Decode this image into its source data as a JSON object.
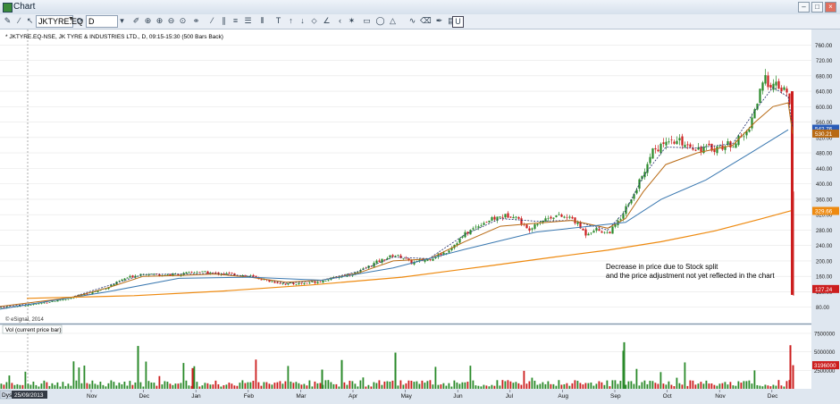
{
  "window": {
    "title": "Chart"
  },
  "toolbar": {
    "symbol": "JKTYRE.EQ",
    "interval": "D"
  },
  "chart_header": "* JKTYRE.EQ-NSE, JK TYRE & INDUSTRIES LTD., D, 09:15-15:30 (500 Bars Back)",
  "copyright": "© eSignal, 2014",
  "volume_pane_label": "Vol (current price bar)",
  "annotation": {
    "line1": "Decrease in price due to Stock split",
    "line2": "and the price adjustment not yet reflected in the chart"
  },
  "date_box": {
    "prefix": "Dys",
    "date": "25/09/2013"
  },
  "colors": {
    "up": "#2a8a2a",
    "down": "#cc1e1e",
    "ma_fast": "#1e2a6a",
    "ma_mid": "#b86a14",
    "ma_slow": "#3a78b0",
    "ma_long": "#ee8a10"
  },
  "chart_data": {
    "type": "line",
    "price_axis": {
      "ylim": [
        40,
        800
      ],
      "ticks": [
        80,
        120,
        160,
        200,
        240,
        280,
        320,
        360,
        400,
        440,
        480,
        520,
        560,
        600,
        640,
        680,
        720,
        760
      ]
    },
    "volume_axis": {
      "ylim": [
        0,
        7500000
      ],
      "ticks": [
        2500000,
        5000000,
        7500000
      ],
      "tick_labels": [
        "2500000",
        "5000000",
        "7500000"
      ]
    },
    "months": [
      "Nov",
      "Dec",
      "Jan",
      "Feb",
      "Mar",
      "Apr",
      "May",
      "Jun",
      "Jul",
      "Aug",
      "Sep",
      "Oct",
      "Nov",
      "Dec"
    ],
    "price_labels": [
      {
        "label": "760.00",
        "value": 760,
        "color": "#dfe7f0"
      },
      {
        "label": "542.76",
        "value": 542.76,
        "color": "#2a5cb8"
      },
      {
        "label": "530.21",
        "value": 530.21,
        "color": "#b86a14"
      },
      {
        "label": "329.66",
        "value": 329.66,
        "color": "#ee8a10"
      },
      {
        "label": "127.24",
        "value": 127.24,
        "color": "#cc1e1e"
      }
    ],
    "volume_label": {
      "label": "3196000",
      "value": 3196000
    },
    "series": [
      {
        "key": "close",
        "points": [
          [
            0,
            78
          ],
          [
            20,
            83
          ],
          [
            40,
            88
          ],
          [
            60,
            96
          ],
          [
            80,
            104
          ],
          [
            100,
            116
          ],
          [
            120,
            132
          ],
          [
            140,
            155
          ],
          [
            160,
            168
          ],
          [
            180,
            164
          ],
          [
            200,
            165
          ],
          [
            220,
            172
          ],
          [
            240,
            168
          ],
          [
            260,
            166
          ],
          [
            280,
            160
          ],
          [
            300,
            148
          ],
          [
            320,
            140
          ],
          [
            340,
            142
          ],
          [
            360,
            148
          ],
          [
            380,
            160
          ],
          [
            400,
            170
          ],
          [
            420,
            196
          ],
          [
            440,
            215
          ],
          [
            450,
            210
          ],
          [
            460,
            195
          ],
          [
            480,
            205
          ],
          [
            500,
            225
          ],
          [
            520,
            270
          ],
          [
            540,
            300
          ],
          [
            560,
            315
          ],
          [
            575,
            320
          ],
          [
            590,
            280
          ],
          [
            600,
            300
          ],
          [
            620,
            318
          ],
          [
            640,
            310
          ],
          [
            655,
            270
          ],
          [
            665,
            283
          ],
          [
            680,
            272
          ],
          [
            690,
            296
          ],
          [
            700,
            340
          ],
          [
            710,
            380
          ],
          [
            720,
            430
          ],
          [
            730,
            490
          ],
          [
            745,
            500
          ],
          [
            760,
            510
          ],
          [
            780,
            492
          ],
          [
            800,
            492
          ],
          [
            820,
            505
          ],
          [
            835,
            530
          ],
          [
            845,
            600
          ],
          [
            855,
            670
          ],
          [
            865,
            655
          ],
          [
            875,
            645
          ],
          [
            882,
            630
          ],
          [
            886,
            510
          ],
          [
            888,
            130
          ]
        ]
      },
      {
        "key": "ma_fast",
        "points": [
          [
            0,
            80
          ],
          [
            40,
            90
          ],
          [
            80,
            106
          ],
          [
            120,
            135
          ],
          [
            160,
            165
          ],
          [
            200,
            166
          ],
          [
            240,
            168
          ],
          [
            280,
            160
          ],
          [
            320,
            142
          ],
          [
            360,
            150
          ],
          [
            400,
            172
          ],
          [
            440,
            210
          ],
          [
            480,
            206
          ],
          [
            520,
            268
          ],
          [
            560,
            310
          ],
          [
            600,
            303
          ],
          [
            640,
            305
          ],
          [
            680,
            280
          ],
          [
            700,
            330
          ],
          [
            720,
            420
          ],
          [
            745,
            495
          ],
          [
            780,
            493
          ],
          [
            820,
            504
          ],
          [
            845,
            590
          ],
          [
            865,
            650
          ],
          [
            882,
            625
          ],
          [
            887,
            545
          ]
        ]
      },
      {
        "key": "ma_mid",
        "points": [
          [
            0,
            82
          ],
          [
            80,
            105
          ],
          [
            120,
            130
          ],
          [
            160,
            160
          ],
          [
            200,
            162
          ],
          [
            240,
            166
          ],
          [
            280,
            158
          ],
          [
            320,
            145
          ],
          [
            360,
            150
          ],
          [
            400,
            168
          ],
          [
            440,
            200
          ],
          [
            480,
            205
          ],
          [
            520,
            250
          ],
          [
            560,
            290
          ],
          [
            600,
            298
          ],
          [
            640,
            305
          ],
          [
            680,
            285
          ],
          [
            700,
            310
          ],
          [
            720,
            380
          ],
          [
            745,
            450
          ],
          [
            780,
            480
          ],
          [
            820,
            500
          ],
          [
            845,
            560
          ],
          [
            865,
            600
          ],
          [
            882,
            610
          ],
          [
            887,
            530
          ]
        ]
      },
      {
        "key": "ma_slow",
        "points": [
          [
            0,
            75
          ],
          [
            120,
            120
          ],
          [
            200,
            155
          ],
          [
            280,
            158
          ],
          [
            360,
            150
          ],
          [
            440,
            182
          ],
          [
            520,
            230
          ],
          [
            600,
            275
          ],
          [
            660,
            290
          ],
          [
            700,
            300
          ],
          [
            740,
            360
          ],
          [
            790,
            410
          ],
          [
            840,
            480
          ],
          [
            882,
            540
          ]
        ]
      },
      {
        "key": "ma_long",
        "points": [
          [
            30,
            103
          ],
          [
            150,
            110
          ],
          [
            250,
            122
          ],
          [
            350,
            138
          ],
          [
            450,
            158
          ],
          [
            550,
            188
          ],
          [
            620,
            210
          ],
          [
            680,
            228
          ],
          [
            740,
            250
          ],
          [
            800,
            278
          ],
          [
            850,
            308
          ],
          [
            885,
            330
          ]
        ]
      }
    ]
  }
}
